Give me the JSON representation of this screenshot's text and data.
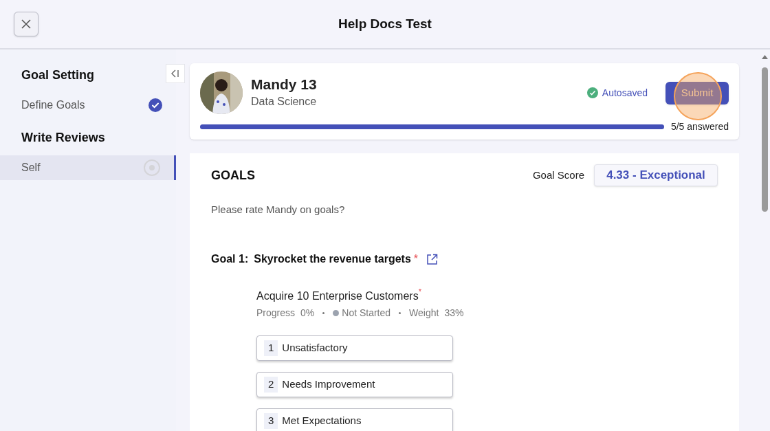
{
  "header": {
    "title": "Help Docs Test"
  },
  "sidebar": {
    "sections": [
      {
        "title": "Goal Setting",
        "items": [
          {
            "label": "Define Goals",
            "completed": true,
            "selected": false
          }
        ]
      },
      {
        "title": "Write Reviews",
        "items": [
          {
            "label": "Self",
            "completed": false,
            "selected": true
          }
        ]
      }
    ]
  },
  "profile": {
    "name": "Mandy 13",
    "department": "Data Science",
    "save_status": "Autosaved",
    "submit_label": "Submit",
    "click_highlight": true,
    "progress": {
      "level": 1,
      "reading": "5/5 answered"
    }
  },
  "goals": {
    "heading": "GOALS",
    "score_label": "Goal Score",
    "score": "4.33 - Exceptional",
    "prompt": "Please rate Mandy on goals?",
    "goal": {
      "number": "Goal 1:",
      "title": "Skyrocket the revenue targets",
      "required_mark": "*",
      "key_result": {
        "title": "Acquire 10 Enterprise Customers",
        "required_mark": "*",
        "progress_label": "Progress",
        "progress": "0%",
        "status": {
          "label": "Not Started",
          "color": "#9ca3af"
        },
        "weight_label": "Weight",
        "weight": "33%"
      },
      "options": [
        {
          "number": "1",
          "label": "Unsatisfactory",
          "selected": false
        },
        {
          "number": "2",
          "label": "Needs Improvement",
          "selected": false
        },
        {
          "number": "3",
          "label": "Met Expectations",
          "selected": false
        }
      ]
    }
  }
}
